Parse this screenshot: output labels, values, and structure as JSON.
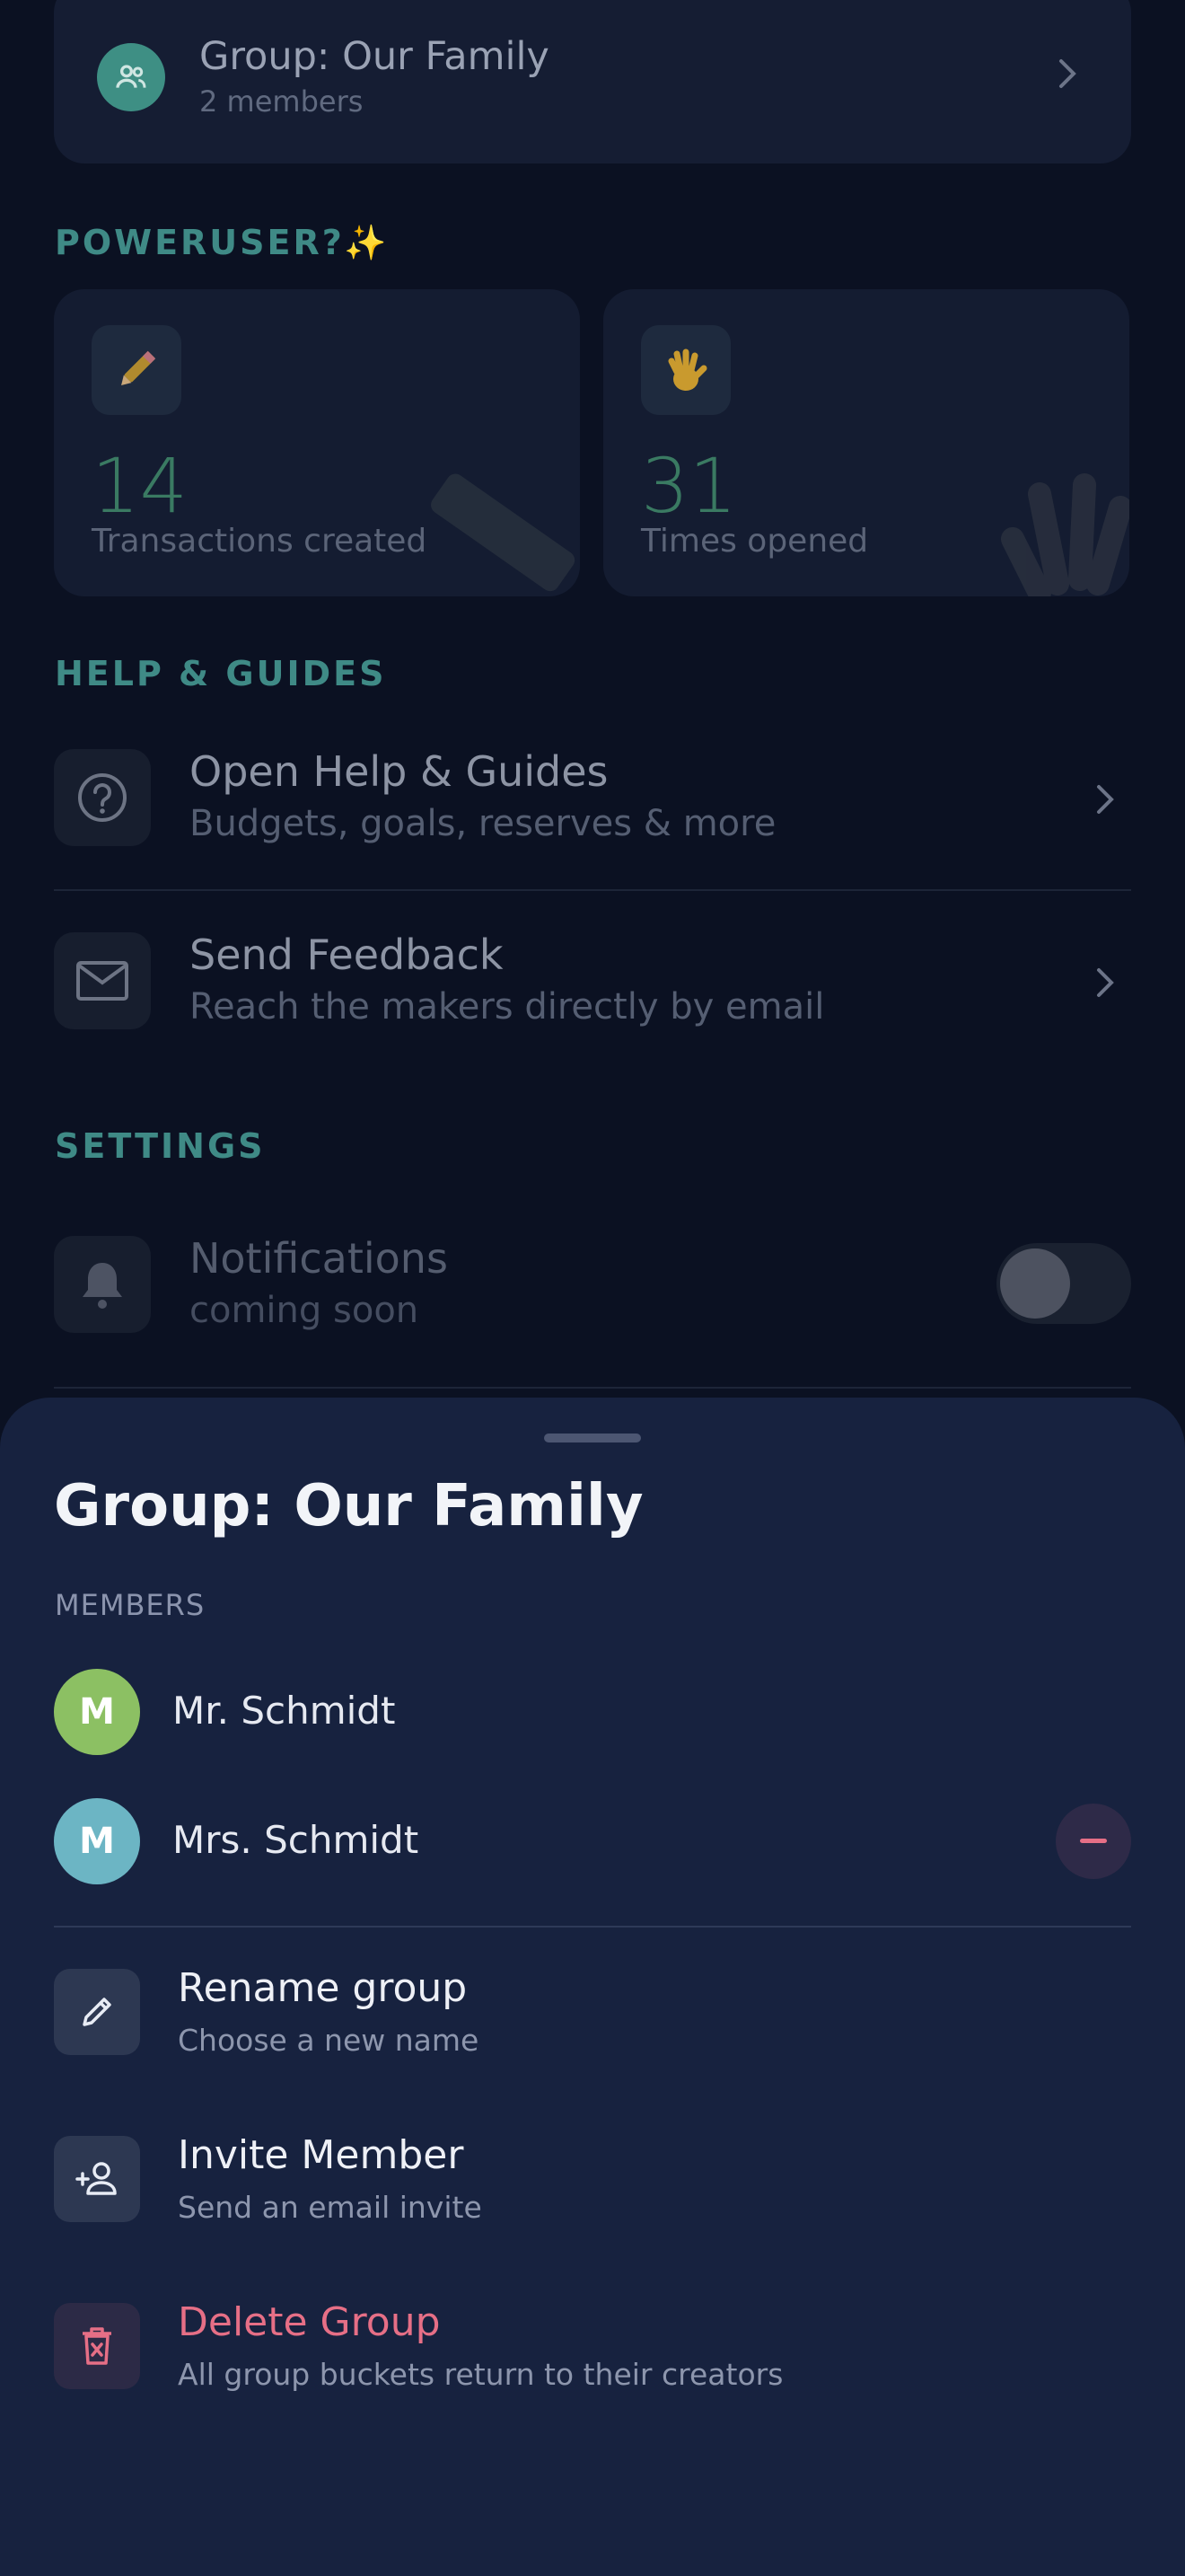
{
  "group_card": {
    "title": "Group: Our Family",
    "subtitle": "2 members",
    "icon": "people-icon"
  },
  "poweruser": {
    "label": "POWERUSER?",
    "sparkle": "✨",
    "stats": [
      {
        "emoji": "✏️",
        "value": "14",
        "caption": "Transactions created"
      },
      {
        "emoji": "👋",
        "value": "31",
        "caption": "Times opened"
      }
    ]
  },
  "help": {
    "label": "HELP & GUIDES",
    "items": [
      {
        "title": "Open Help & Guides",
        "subtitle": "Budgets, goals, reserves & more",
        "icon": "help-circle-icon"
      },
      {
        "title": "Send Feedback",
        "subtitle": "Reach the makers directly by email",
        "icon": "mail-icon"
      }
    ]
  },
  "settings": {
    "label": "SETTINGS",
    "notifications": {
      "title": "Notifications",
      "subtitle": "coming soon",
      "enabled": false
    }
  },
  "sheet": {
    "title": "Group: Our Family",
    "members_label": "MEMBERS",
    "members": [
      {
        "initial": "M",
        "name": "Mr. Schmidt",
        "color": "#8cc063"
      },
      {
        "initial": "M",
        "name": "Mrs. Schmidt",
        "color": "#6cb5c4"
      }
    ],
    "actions": [
      {
        "title": "Rename group",
        "subtitle": "Choose a new name",
        "icon": "pencil-icon"
      },
      {
        "title": "Invite Member",
        "subtitle": "Send an email invite",
        "icon": "person-add-icon"
      },
      {
        "title": "Delete Group",
        "subtitle": "All group buckets return to their creators",
        "icon": "trash-icon",
        "danger": true
      }
    ]
  },
  "colors": {
    "accent_teal": "#3f8a86",
    "danger": "#e66f86",
    "sheet_bg": "#17223f",
    "page_bg": "#0b1122"
  }
}
